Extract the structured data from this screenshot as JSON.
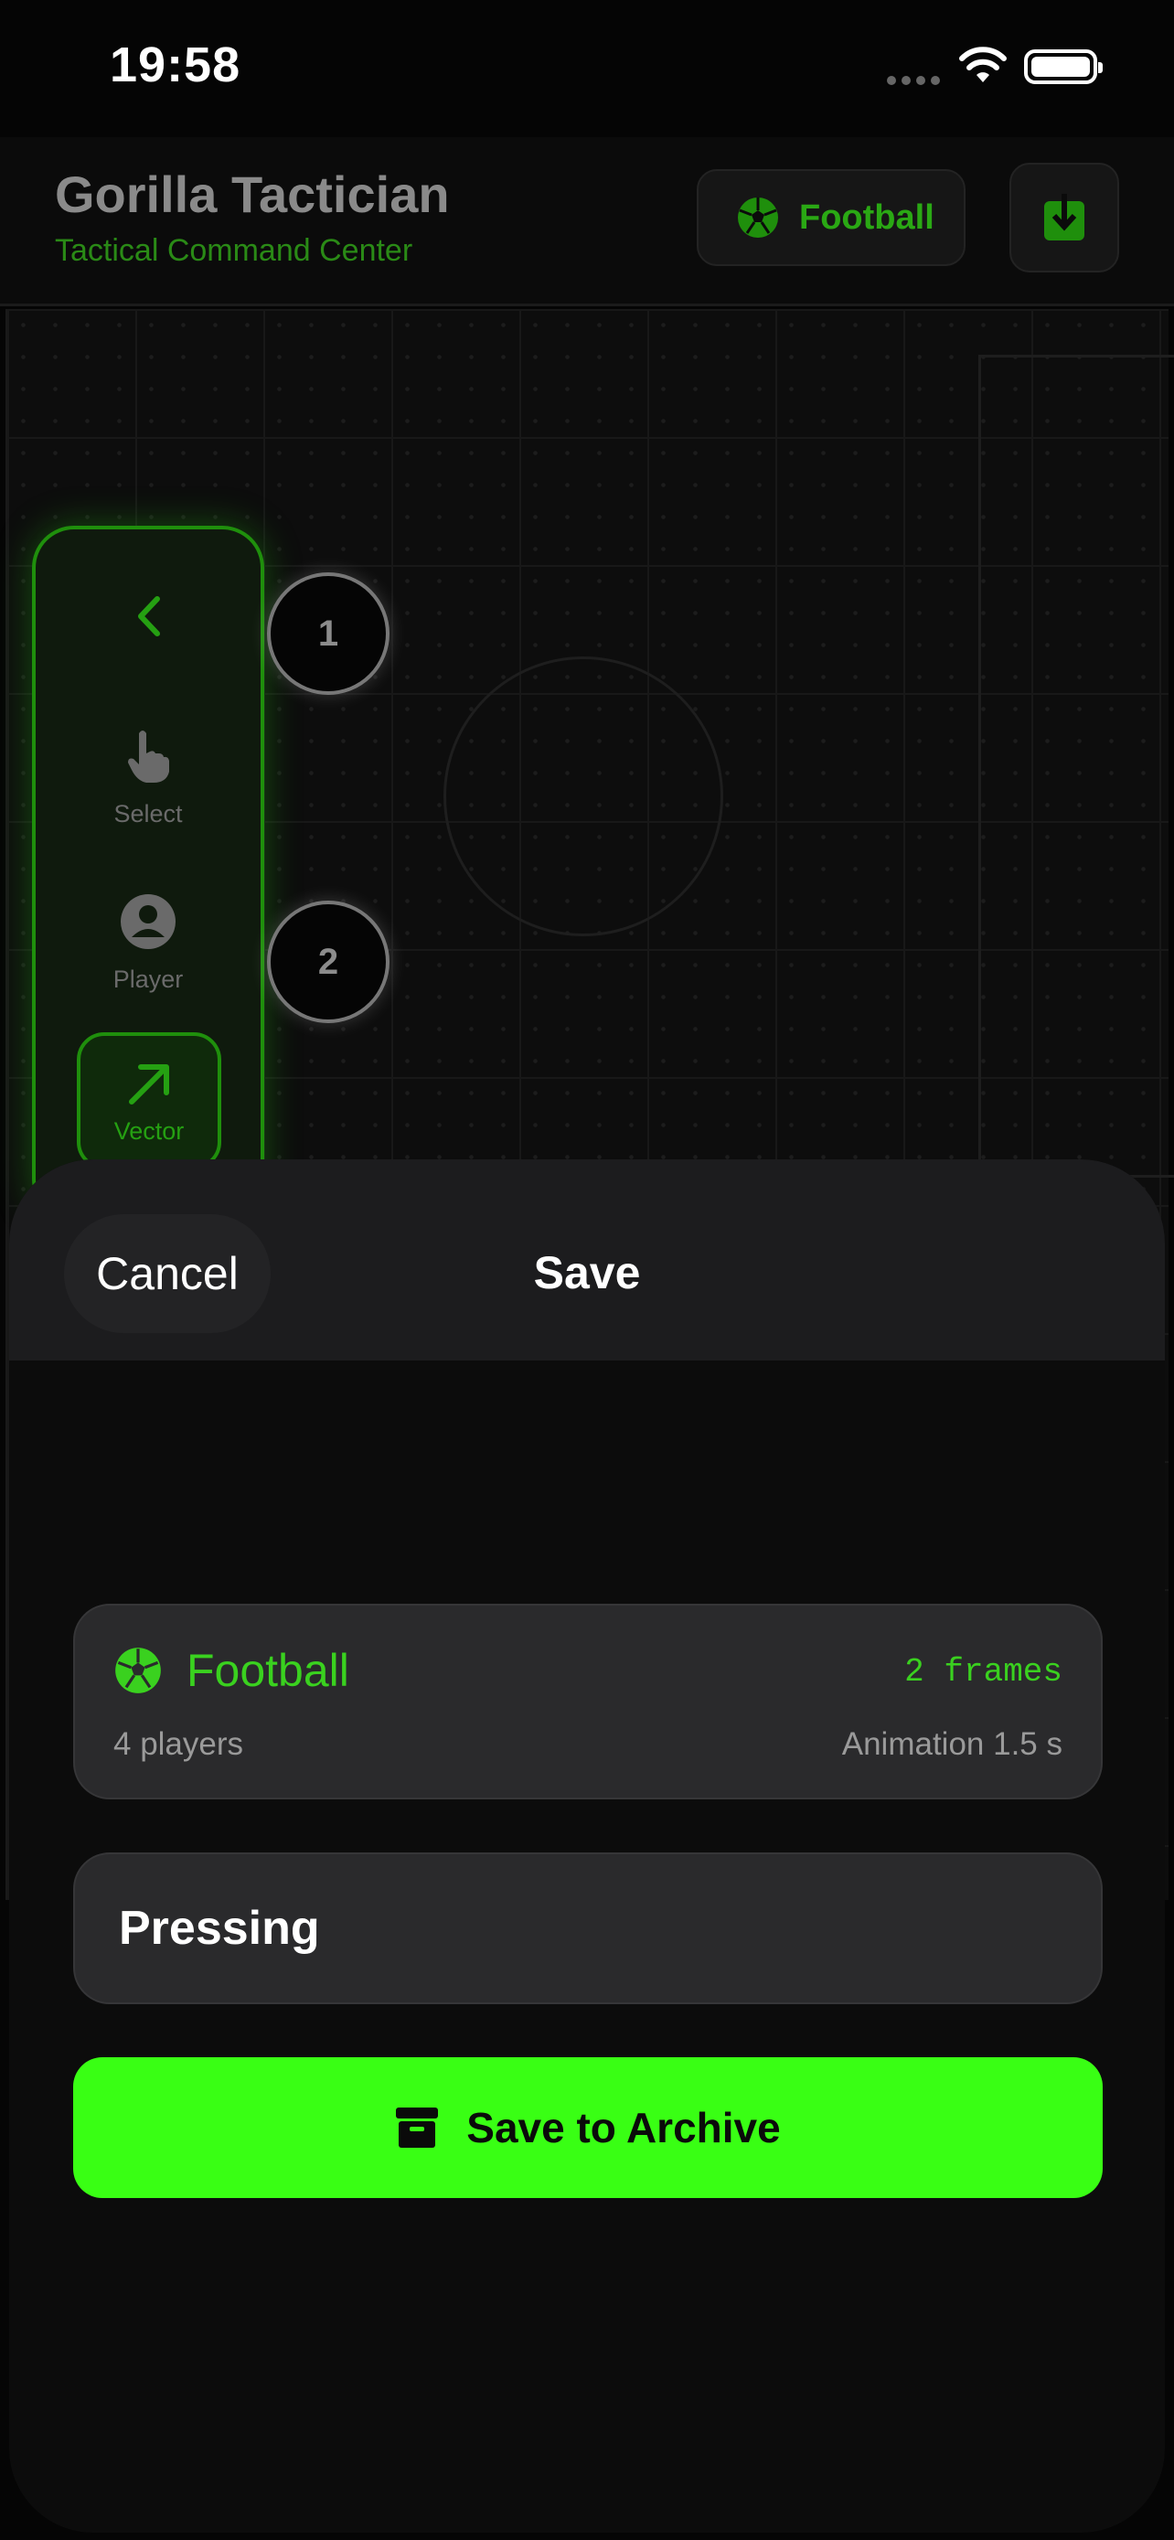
{
  "status_bar": {
    "time": "19:58"
  },
  "header": {
    "title": "Gorilla Tactician",
    "subtitle": "Tactical Command Center",
    "sport_button_label": "Football"
  },
  "toolbar": {
    "items": [
      {
        "label": "Select",
        "icon": "hand-pointer-icon"
      },
      {
        "label": "Player",
        "icon": "person-circle-icon"
      },
      {
        "label": "Vector",
        "icon": "arrow-up-right-icon",
        "selected": true
      }
    ]
  },
  "pitch": {
    "players": [
      {
        "number": "1"
      },
      {
        "number": "2"
      }
    ]
  },
  "sheet": {
    "cancel_label": "Cancel",
    "title": "Save",
    "summary": {
      "sport": "Football",
      "frames": "2 frames",
      "players": "4 players",
      "animation": "Animation 1.5 s"
    },
    "name_value": "Pressing",
    "save_button_label": "Save to Archive"
  },
  "colors": {
    "accent": "#39ff14",
    "accent_text": "#3ad11f",
    "sheet_background": "#0c0c0c",
    "card_background": "#2a2a2c"
  }
}
